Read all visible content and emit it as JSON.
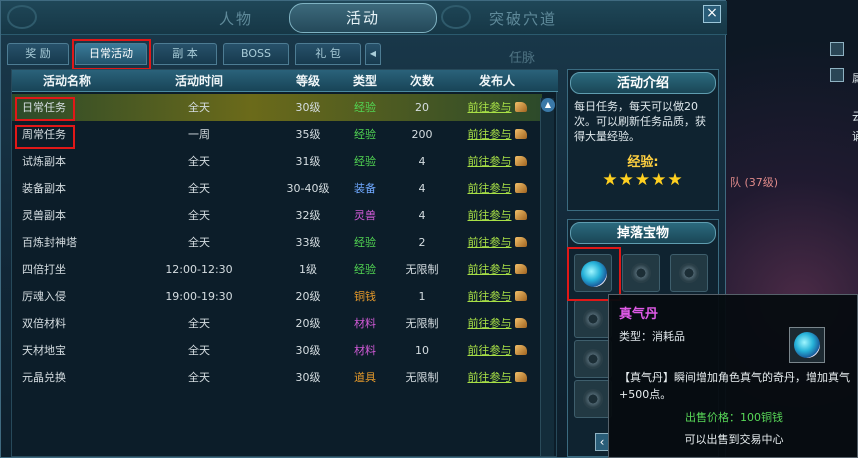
{
  "top_tabs": {
    "left": "人物",
    "active": "活动",
    "right": "突破穴道"
  },
  "close_label": "×",
  "sub_tabs": [
    "奖 励",
    "日常活动",
    "副 本",
    "BOSS",
    "礼 包"
  ],
  "sub_tab_arrow": "◀",
  "behind_tab_hint": "任脉",
  "table": {
    "headers": [
      "活动名称",
      "活动时间",
      "等级",
      "类型",
      "次数",
      "发布人"
    ],
    "link_text": "前往参与",
    "rows": [
      {
        "name": "日常任务",
        "time": "全天",
        "level": "30级",
        "type": "经验",
        "type_color": "green",
        "count": "20"
      },
      {
        "name": "周常任务",
        "time": "一周",
        "level": "35级",
        "type": "经验",
        "type_color": "green",
        "count": "200"
      },
      {
        "name": "试炼副本",
        "time": "全天",
        "level": "31级",
        "type": "经验",
        "type_color": "green",
        "count": "4"
      },
      {
        "name": "装备副本",
        "time": "全天",
        "level": "30-40级",
        "type": "装备",
        "type_color": "blue",
        "count": "4"
      },
      {
        "name": "灵兽副本",
        "time": "全天",
        "level": "32级",
        "type": "灵兽",
        "type_color": "purple",
        "count": "4"
      },
      {
        "name": "百炼封神塔",
        "time": "全天",
        "level": "33级",
        "type": "经验",
        "type_color": "green",
        "count": "2"
      },
      {
        "name": "四倍打坐",
        "time": "12:00-12:30",
        "level": "1级",
        "type": "经验",
        "type_color": "green",
        "count": "无限制"
      },
      {
        "name": "厉魂入侵",
        "time": "19:00-19:30",
        "level": "20级",
        "type": "铜钱",
        "type_color": "orange",
        "count": "1"
      },
      {
        "name": "双倍材料",
        "time": "全天",
        "level": "20级",
        "type": "材料",
        "type_color": "purple",
        "count": "无限制"
      },
      {
        "name": "天材地宝",
        "time": "全天",
        "level": "30级",
        "type": "材料",
        "type_color": "purple",
        "count": "10"
      },
      {
        "name": "元晶兑换",
        "time": "全天",
        "level": "30级",
        "type": "道具",
        "type_color": "orange",
        "count": "无限制"
      }
    ]
  },
  "intro": {
    "title": "活动介绍",
    "text": "每日任务，每天可以做20次。可以刷新任务品质，获得大量经验。",
    "exp_label": "经验:",
    "stars": "★★★★★"
  },
  "drops": {
    "title": "掉落宝物"
  },
  "tooltip": {
    "name": "真气丹",
    "type": "类型：消耗品",
    "desc": "【真气丹】瞬间增加角色真气的奇丹，增加真气+500点。",
    "price": "出售价格：100铜钱",
    "note": "可以出售到交易中心"
  },
  "scene": {
    "team_text": "队 (37级)",
    "partial_chars": [
      "属",
      "云",
      "诵"
    ]
  },
  "colors": {
    "green": "#52d652",
    "blue": "#6fa8ff",
    "purple": "#d05ad6",
    "orange": "#e69a2a",
    "highlight": "#e01818"
  }
}
